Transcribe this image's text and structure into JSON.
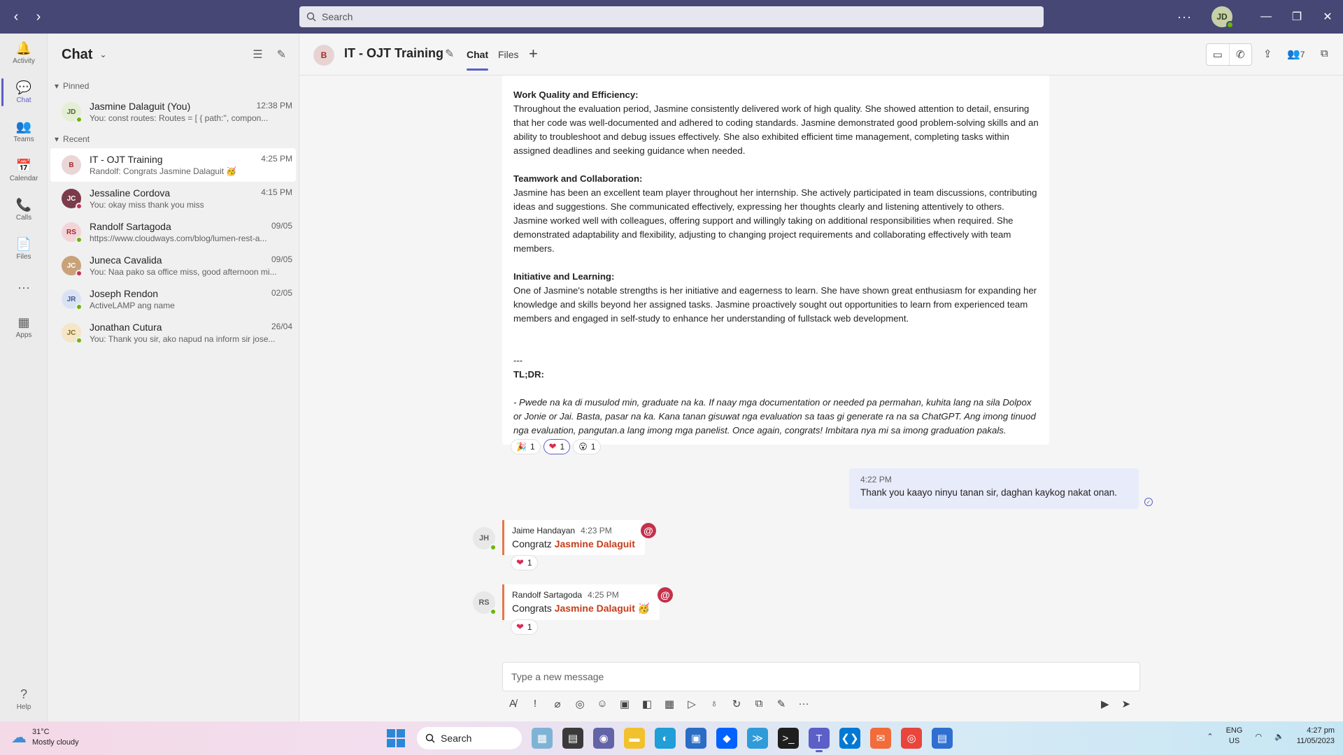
{
  "titlebar": {
    "search_placeholder": "Search",
    "more": "···",
    "avatar_initials": "JD"
  },
  "rail": [
    {
      "label": "Activity",
      "icon": "bell-icon",
      "glyph": "🔔"
    },
    {
      "label": "Chat",
      "icon": "chat-icon",
      "glyph": "💬"
    },
    {
      "label": "Teams",
      "icon": "teams-icon",
      "glyph": "👥"
    },
    {
      "label": "Calendar",
      "icon": "calendar-icon",
      "glyph": "📅"
    },
    {
      "label": "Calls",
      "icon": "phone-icon",
      "glyph": "📞"
    },
    {
      "label": "Files",
      "icon": "file-icon",
      "glyph": "📄"
    },
    {
      "label": "",
      "icon": "more-icon",
      "glyph": "···"
    },
    {
      "label": "Apps",
      "icon": "apps-icon",
      "glyph": "▦"
    }
  ],
  "rail_help": "Help",
  "chatlist": {
    "title": "Chat",
    "pinned_label": "Pinned",
    "recent_label": "Recent",
    "pinned": [
      {
        "initials": "JD",
        "name": "Jasmine Dalaguit (You)",
        "time": "12:38 PM",
        "preview": "You: const routes: Routes = [ { path:'', compon...",
        "avatar_bg": "#e3eed4",
        "avatar_fg": "#4f6b2b",
        "status": "green"
      }
    ],
    "recent": [
      {
        "initials": "B",
        "name": "IT - OJT Training",
        "time": "4:25 PM",
        "preview": "Randolf: Congrats Jasmine Dalaguit 🥳",
        "avatar_bg": "#ead6d6",
        "avatar_fg": "#a52a2a",
        "status": "none"
      },
      {
        "initials": "JC",
        "name": "Jessaline Cordova",
        "time": "4:15 PM",
        "preview": "You: okay miss thank you miss",
        "avatar_bg": "#7a3b4b",
        "avatar_fg": "#ffffff",
        "status": "red"
      },
      {
        "initials": "RS",
        "name": "Randolf Sartagoda",
        "time": "09/05",
        "preview": "https://www.cloudways.com/blog/lumen-rest-a...",
        "avatar_bg": "#f2d5d8",
        "avatar_fg": "#a4262c",
        "status": "green"
      },
      {
        "initials": "JC",
        "name": "Juneca Cavalida",
        "time": "09/05",
        "preview": "You: Naa pako sa office miss, good afternoon mi...",
        "avatar_bg": "#c9a27a",
        "avatar_fg": "#ffffff",
        "status": "red"
      },
      {
        "initials": "JR",
        "name": "Joseph Rendon",
        "time": "02/05",
        "preview": "ActiveLAMP ang name",
        "avatar_bg": "#dbe3f3",
        "avatar_fg": "#3e5a99",
        "status": "green"
      },
      {
        "initials": "JC",
        "name": "Jonathan Cutura",
        "time": "26/04",
        "preview": "You: Thank you sir, ako napud na inform sir jose...",
        "avatar_bg": "#f4e6c6",
        "avatar_fg": "#8a6a1f",
        "status": "green"
      }
    ]
  },
  "header": {
    "avatar_initials": "B",
    "title": "IT - OJT Training",
    "tab_chat": "Chat",
    "tab_files": "Files",
    "plus": "+",
    "participants_count": "7"
  },
  "message_main": {
    "s1_title": "Work Quality and Efficiency:",
    "s1_body": "Throughout the evaluation period, Jasmine consistently delivered work of high quality. She showed attention to detail, ensuring that her code was well-documented and adhered to coding standards. Jasmine demonstrated good problem-solving skills and an ability to troubleshoot and debug issues effectively. She also exhibited efficient time management, completing tasks within assigned deadlines and seeking guidance when needed.",
    "s2_title": "Teamwork and Collaboration:",
    "s2_body": "Jasmine has been an excellent team player throughout her internship. She actively participated in team discussions, contributing ideas and suggestions. She communicated effectively, expressing her thoughts clearly and listening attentively to others. Jasmine worked well with colleagues, offering support and willingly taking on additional responsibilities when required. She demonstrated adaptability and flexibility, adjusting to changing project requirements and collaborating effectively with team members.",
    "s3_title": "Initiative and Learning:",
    "s3_body": "One of Jasmine's notable strengths is her initiative and eagerness to learn. She have shown great enthusiasm for expanding her knowledge and skills beyond her assigned tasks. Jasmine proactively sought out opportunities to learn from experienced team members and engaged in self-study to enhance her understanding of fullstack web development.",
    "divider": "---",
    "tldr": "TL;DR:",
    "summary": "- Pwede na ka di musulod min, graduate na ka. If naay mga documentation or needed pa permahan, kuhita lang na sila Dolpox or Jonie or Jai. Basta, pasar na ka. Kana tanan gisuwat nga evaluation sa taas gi generate ra na sa ChatGPT. Ang imong tinuod nga evaluation, pangutan.a lang imong mga panelist. Once again, congrats! Imbitara nya mi sa imong graduation pakals.",
    "reactions": [
      {
        "emoji": "🎉",
        "count": "1"
      },
      {
        "emoji": "❤",
        "count": "1"
      },
      {
        "emoji": "😮",
        "count": "1"
      }
    ]
  },
  "message_self": {
    "time": "4:22 PM",
    "text": "Thank you kaayo ninyu tanan sir, daghan kaykog nakat onan."
  },
  "message_jaime": {
    "initials": "JH",
    "sender": "Jaime Handayan",
    "time": "4:23 PM",
    "text": "Congratz",
    "mention": "Jasmine Dalaguit",
    "reaction_count": "1"
  },
  "message_randolf": {
    "initials": "RS",
    "sender": "Randolf Sartagoda",
    "time": "4:25 PM",
    "text": "Congrats",
    "mention": "Jasmine Dalaguit",
    "emoji": "🥳",
    "reaction_count": "1"
  },
  "compose": {
    "placeholder": "Type a new message"
  },
  "taskbar": {
    "temp": "31°C",
    "weather": "Mostly cloudy",
    "search": "Search",
    "lang1": "ENG",
    "lang2": "US",
    "time": "4:27 pm",
    "date": "11/05/2023"
  },
  "colors": {
    "titlebar": "#464775",
    "accent": "#5b5fc7",
    "mention": "#c43e1c",
    "self_bubble": "#e8ebfa"
  }
}
